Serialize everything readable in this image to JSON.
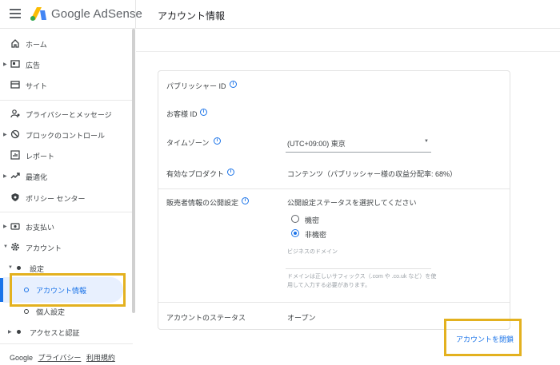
{
  "header": {
    "brand": "Google AdSense",
    "page_title": "アカウント情報"
  },
  "sidebar": {
    "items": {
      "home": "ホーム",
      "ads": "広告",
      "sites": "サイト",
      "privacy": "プライバシーとメッセージ",
      "blocking": "ブロックのコントロール",
      "reports": "レポート",
      "optimization": "最適化",
      "policy": "ポリシー センター",
      "payments": "お支払い",
      "account": "アカウント",
      "settings": "設定",
      "account_info": "アカウント情報",
      "personal": "個人設定",
      "access": "アクセスと認証"
    },
    "footer": {
      "google": "Google",
      "privacy": "プライバシー",
      "terms": "利用規約"
    }
  },
  "account": {
    "publisher_id_label": "パブリッシャー ID",
    "customer_id_label": "お客様 ID",
    "timezone_label": "タイムゾーン",
    "timezone_value": "(UTC+09:00) 東京",
    "products_label": "有効なプロダクト",
    "products_value": "コンテンツ（パブリッシャー様の収益分配率: 68%）",
    "seller_label": "販売者情報の公開設定",
    "seller_prompt": "公開設定ステータスを選択してください",
    "option_confidential": "機密",
    "option_nonconfidential": "非機密",
    "business_domain_label": "ビジネスのドメイン",
    "domain_hint_line1": "ドメインは正しいサフィックス（.com や .co.uk など）を使",
    "domain_hint_line2": "用して入力する必要があります。",
    "status_label": "アカウントのステータス",
    "status_value": "オープン",
    "close_account": "アカウントを閉鎖"
  },
  "colors": {
    "accent": "#1a73e8",
    "highlight": "#e3b11f"
  }
}
